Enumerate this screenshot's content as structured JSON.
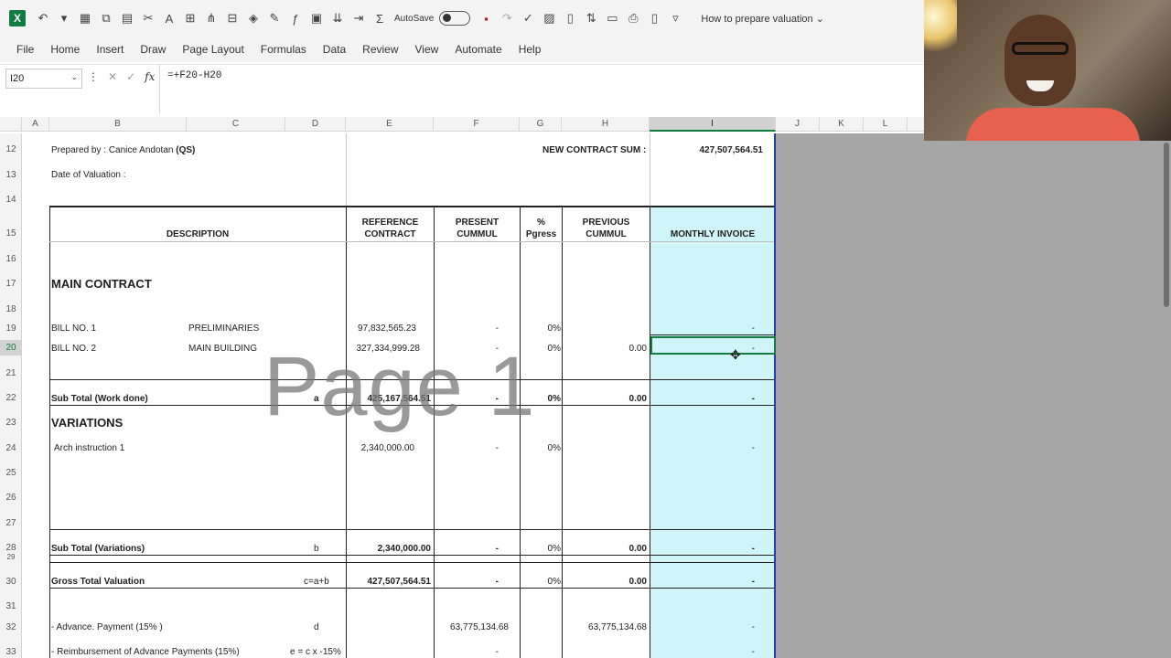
{
  "ribbon": {
    "autosave_label": "AutoSave",
    "doc_title": "How to prepare valuation",
    "menu": [
      "File",
      "Home",
      "Insert",
      "Draw",
      "Page Layout",
      "Formulas",
      "Data",
      "Review",
      "View",
      "Automate",
      "Help"
    ]
  },
  "formula_bar": {
    "name_box": "I20",
    "formula": "=+F20-H20"
  },
  "columns": [
    "A",
    "B",
    "C",
    "D",
    "E",
    "F",
    "G",
    "H",
    "I",
    "J",
    "K",
    "L"
  ],
  "rows": [
    "12",
    "13",
    "14",
    "15",
    "16",
    "17",
    "18",
    "19",
    "20",
    "21",
    "22",
    "23",
    "24",
    "25",
    "26",
    "27",
    "28",
    "29",
    "30",
    "31",
    "32",
    "33"
  ],
  "sheet": {
    "prepared_by_label": "Prepared by :",
    "prepared_by_name": "Canice Andotan",
    "prepared_by_role": "(QS)",
    "new_contract_label": "NEW CONTRACT SUM :",
    "new_contract_value": "427,507,564.51",
    "date_label": "Date of Valuation :",
    "headers": {
      "description": "DESCRIPTION",
      "ref_1": "REFERENCE",
      "ref_2": "CONTRACT",
      "present_1": "PRESENT",
      "present_2": "CUMMUL",
      "pct_1": "%",
      "pct_2": "Pgress",
      "prev_1": "PREVIOUS",
      "prev_2": "CUMMUL",
      "monthly": "MONTHLY INVOICE"
    },
    "main_contract": "MAIN CONTRACT",
    "bill1": {
      "no": "BILL NO. 1",
      "name": "PRELIMINARIES",
      "ref": "97,832,565.23",
      "present": "-",
      "pct": "0%",
      "monthly": "-"
    },
    "bill2": {
      "no": "BILL NO. 2",
      "name": "MAIN BUILDING",
      "ref": "327,334,999.28",
      "present": "-",
      "pct": "0%",
      "prev": "0.00",
      "monthly": "-"
    },
    "subtotal_work": {
      "label": "Sub Total (Work done)",
      "code": "a",
      "ref": "425,167,564.51",
      "present": "-",
      "pct": "0%",
      "prev": "0.00",
      "monthly": "-"
    },
    "variations": "VARIATIONS",
    "arch": {
      "label": "Arch instruction 1",
      "ref": "2,340,000.00",
      "present": "-",
      "pct": "0%",
      "monthly": "-"
    },
    "subtotal_var": {
      "label": "Sub Total (Variations)",
      "code": "b",
      "ref": "2,340,000.00",
      "present": "-",
      "pct": "0%",
      "prev": "0.00",
      "monthly": "-"
    },
    "gross": {
      "label": "Gross Total Valuation",
      "code": "c=a+b",
      "ref": "427,507,564.51",
      "present": "-",
      "pct": "0%",
      "prev": "0.00",
      "monthly": "-"
    },
    "advance": {
      "label": "- Advance. Payment (15% )",
      "code": "d",
      "present": "63,775,134.68",
      "prev": "63,775,134.68",
      "monthly": "-"
    },
    "reimb": {
      "label": "- Reimbursement of Advance Payments (15%)",
      "code": "e = c x  -15%",
      "present": "-",
      "monthly": "-"
    }
  },
  "watermark": "Page 1"
}
